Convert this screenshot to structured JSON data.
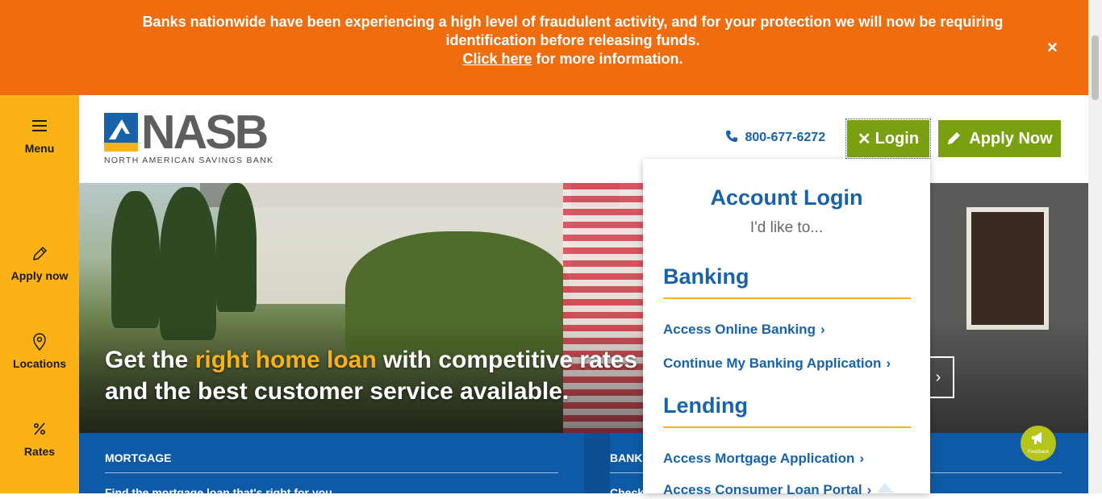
{
  "alert": {
    "message": "Banks nationwide have been experiencing a high level of fraudulent activity, and for your protection we will now be requiring identification before releasing funds.",
    "link_text": "Click here",
    "link_suffix": " for more information.",
    "close": "×"
  },
  "sidenav": {
    "items": [
      {
        "label": "Menu",
        "icon": "hamburger-icon"
      },
      {
        "label": "Apply now",
        "icon": "pencil-icon"
      },
      {
        "label": "Locations",
        "icon": "map-pin-icon"
      },
      {
        "label": "Rates",
        "icon": "percent-icon"
      }
    ]
  },
  "header": {
    "logo_word": "NASB",
    "logo_sub": "NORTH AMERICAN SAVINGS BANK",
    "phone": "800-677-6272",
    "login_label": "Login",
    "apply_label": "Apply Now"
  },
  "hero": {
    "headline_pre": "Get the ",
    "headline_highlight": "right home loan",
    "headline_post": " with competitive rates and the best customer service available."
  },
  "lower": {
    "col1_title": "MORTGAGE",
    "col1_sub": "Find the mortgage loan that's right for you",
    "col2_title": "BANKING",
    "col2_sub": "Check out our banking products"
  },
  "login_dropdown": {
    "title": "Account Login",
    "subtitle": "I'd like to...",
    "banking_heading": "Banking",
    "banking_links": [
      "Access Online Banking",
      "Continue My Banking Application"
    ],
    "lending_heading": "Lending",
    "lending_links": [
      "Access Mortgage Application",
      "Access Consumer Loan Portal"
    ]
  },
  "feedback": {
    "label": "Feedback",
    "color": "#b6c51a"
  },
  "colors": {
    "orange": "#ef6c0f",
    "yellow": "#fbb216",
    "blue": "#1862a9",
    "green": "#7aa012"
  }
}
